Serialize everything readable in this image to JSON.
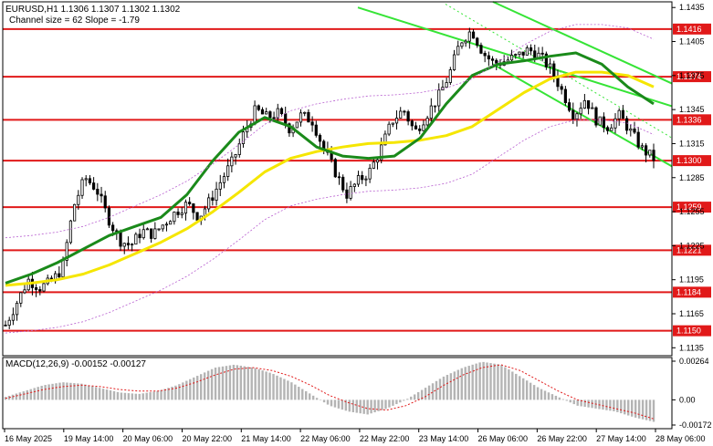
{
  "header": {
    "symbol_line": "EURUSD,H1  1.1306 1.1307 1.1302 1.1302",
    "channel_line": "Channel size = 62 Slope = -1.79"
  },
  "macd": {
    "label": "MACD(12,26,9) -0.00152 -0.00127",
    "ticks": [
      "0.00264",
      "0.00",
      "-0.00172"
    ]
  },
  "chart_data": {
    "type": "candlestick",
    "title": "EURUSD,H1",
    "ylim": [
      1.1128,
      1.144
    ],
    "price_ticks": [
      "1.1435",
      "1.1405",
      "1.1375",
      "1.1345",
      "1.1315",
      "1.1285",
      "1.1255",
      "1.1225",
      "1.1195",
      "1.1165",
      "1.1135"
    ],
    "x_ticks": [
      "16 May 2025",
      "19 May 14:00",
      "20 May 06:00",
      "20 May 22:00",
      "21 May 14:00",
      "22 May 06:00",
      "22 May 22:00",
      "23 May 14:00",
      "26 May 06:00",
      "26 May 22:00",
      "27 May 14:00",
      "28 May 06:00"
    ],
    "levels": [
      {
        "value": 1.1416,
        "label": "1.1416"
      },
      {
        "value": 1.1374,
        "label": "1.1374"
      },
      {
        "value": 1.1336,
        "label": "1.1336"
      },
      {
        "value": 1.13,
        "label": "1.1300"
      },
      {
        "value": 1.1259,
        "label": "1.1259"
      },
      {
        "value": 1.1221,
        "label": "1.1221"
      },
      {
        "value": 1.1184,
        "label": "1.1184"
      },
      {
        "value": 1.115,
        "label": "1.1150"
      }
    ],
    "current_price": "1.1300",
    "close_path": [
      1.1155,
      1.1175,
      1.1195,
      1.1188,
      1.1193,
      1.1205,
      1.126,
      1.1285,
      1.1275,
      1.125,
      1.123,
      1.1225,
      1.1238,
      1.1235,
      1.1245,
      1.1255,
      1.1262,
      1.125,
      1.1265,
      1.1283,
      1.13,
      1.1325,
      1.1345,
      1.1338,
      1.1342,
      1.1328,
      1.134,
      1.1335,
      1.131,
      1.129,
      1.127,
      1.1282,
      1.129,
      1.131,
      1.1335,
      1.1345,
      1.1325,
      1.134,
      1.1355,
      1.1375,
      1.1405,
      1.1415,
      1.1395,
      1.1385,
      1.1388,
      1.1392,
      1.1398,
      1.1392,
      1.138,
      1.136,
      1.134,
      1.1355,
      1.1335,
      1.133,
      1.134,
      1.1325,
      1.131,
      1.1302
    ],
    "series": [
      {
        "name": "MA slow",
        "color": "#f5e600",
        "values": [
          1.119,
          1.1192,
          1.1195,
          1.12,
          1.1208,
          1.1218,
          1.1228,
          1.124,
          1.1255,
          1.1272,
          1.129,
          1.1302,
          1.1308,
          1.1312,
          1.1315,
          1.1316,
          1.1318,
          1.1322,
          1.133,
          1.1345,
          1.136,
          1.1372,
          1.1378,
          1.1378,
          1.1375,
          1.1365
        ]
      },
      {
        "name": "MA fast",
        "color": "#1a8a1a",
        "values": [
          1.1192,
          1.12,
          1.121,
          1.1222,
          1.1234,
          1.1242,
          1.125,
          1.127,
          1.13,
          1.1325,
          1.1338,
          1.133,
          1.1312,
          1.1304,
          1.1302,
          1.1304,
          1.132,
          1.135,
          1.1375,
          1.1385,
          1.1388,
          1.1392,
          1.1395,
          1.1385,
          1.1365,
          1.135
        ]
      }
    ],
    "channel": {
      "upper": [
        1.1435,
        1.1348
      ],
      "lower": [
        1.1385,
        1.1295
      ],
      "top_line": [
        1.144,
        1.1368
      ]
    },
    "macd_histogram": [
      0.0002,
      0.0006,
      0.001,
      0.0012,
      0.0011,
      0.0008,
      0.0005,
      0.0004,
      0.0006,
      0.001,
      0.0016,
      0.0022,
      0.0024,
      0.0022,
      0.0018,
      0.0012,
      0.0004,
      -0.0004,
      -0.0008,
      -0.001,
      -0.0006,
      0.0,
      0.0008,
      0.0016,
      0.0022,
      0.0026,
      0.0024,
      0.0016,
      0.0008,
      0.0002,
      -0.0004,
      -0.0006,
      -0.0008,
      -0.0012,
      -0.0015
    ],
    "macd_signal": [
      0.0001,
      0.0004,
      0.0007,
      0.0009,
      0.001,
      0.0009,
      0.0007,
      0.0006,
      0.0006,
      0.0008,
      0.0012,
      0.0017,
      0.0021,
      0.0022,
      0.002,
      0.0016,
      0.001,
      0.0003,
      -0.0002,
      -0.0006,
      -0.0007,
      -0.0004,
      0.0002,
      0.001,
      0.0017,
      0.0022,
      0.0024,
      0.002,
      0.0013,
      0.0006,
      0.0,
      -0.0003,
      -0.0006,
      -0.0009,
      -0.0013
    ]
  }
}
